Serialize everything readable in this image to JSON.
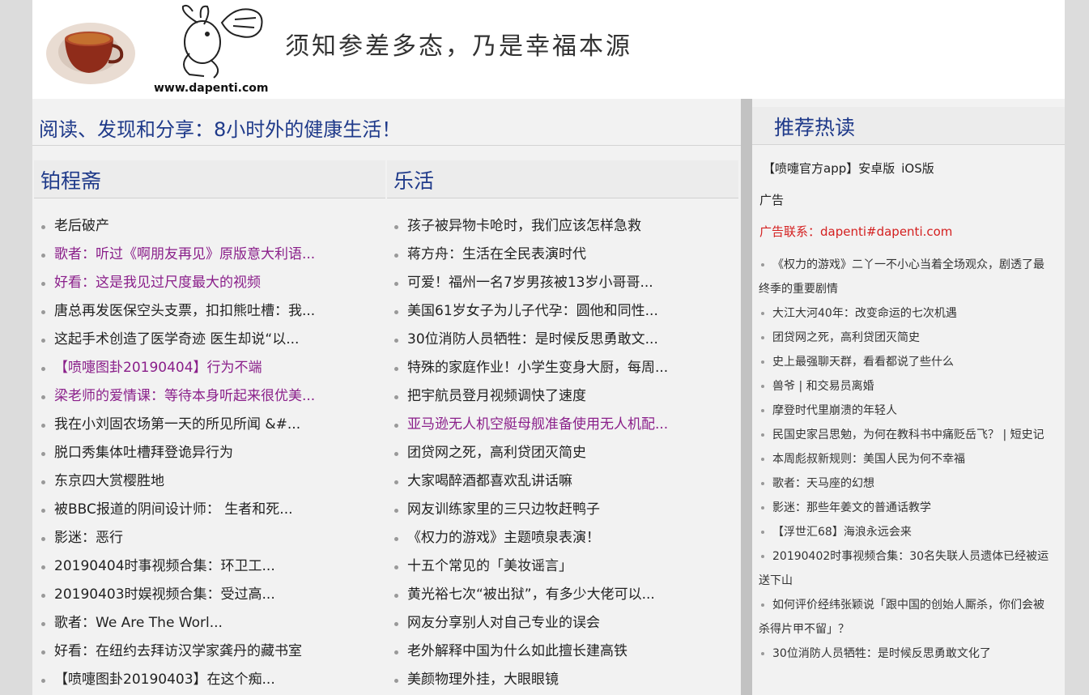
{
  "header": {
    "site_url": "www.dapenti.com",
    "slogan": "须知参差多态，乃是幸福本源"
  },
  "main": {
    "title": "阅读、发现和分享：8小时外的健康生活！"
  },
  "col1": {
    "heading": "铂程斋",
    "items": [
      {
        "text": "老后破产",
        "visited": false
      },
      {
        "text": "歌者：听过《啊朋友再见》原版意大利语...",
        "visited": true
      },
      {
        "text": "好看：这是我见过尺度最大的视频",
        "visited": true
      },
      {
        "text": "唐总再发医保空头支票，扣扣熊吐槽：我...",
        "visited": false
      },
      {
        "text": "这起手术创造了医学奇迹 医生却说“以...",
        "visited": false
      },
      {
        "text": "【喷嚏图卦20190404】行为不端",
        "visited": true
      },
      {
        "text": "梁老师的爱情课：等待本身听起来很优美...",
        "visited": true
      },
      {
        "text": "我在小刘固农场第一天的所见所闻 &#...",
        "visited": false
      },
      {
        "text": "脱口秀集体吐槽拜登诡异行为",
        "visited": false
      },
      {
        "text": "东京四大赏樱胜地",
        "visited": false
      },
      {
        "text": "被BBC报道的阴间设计师： 生者和死...",
        "visited": false
      },
      {
        "text": "影迷：恶行",
        "visited": false
      },
      {
        "text": "20190404时事视频合集：环卫工...",
        "visited": false
      },
      {
        "text": "20190403时娱视频合集：受过高...",
        "visited": false
      },
      {
        "text": "歌者：We Are The Worl...",
        "visited": false
      },
      {
        "text": "好看：在纽约去拜访汉学家龚丹的藏书室",
        "visited": false
      },
      {
        "text": "【喷嚏图卦20190403】在这个痴...",
        "visited": false
      }
    ]
  },
  "col2": {
    "heading": "乐活",
    "items": [
      {
        "text": "孩子被异物卡呛时，我们应该怎样急救",
        "visited": false
      },
      {
        "text": "蒋方舟：生活在全民表演时代",
        "visited": false
      },
      {
        "text": "可爱！福州一名7岁男孩被13岁小哥哥...",
        "visited": false
      },
      {
        "text": "美国61岁女子为儿子代孕：圆他和同性...",
        "visited": false
      },
      {
        "text": "30位消防人员牺牲：是时候反思勇敢文...",
        "visited": false
      },
      {
        "text": "特殊的家庭作业！小学生变身大厨，每周...",
        "visited": false
      },
      {
        "text": "把宇航员登月视频调快了速度",
        "visited": false
      },
      {
        "text": "亚马逊无人机空艇母舰准备使用无人机配...",
        "visited": true
      },
      {
        "text": "团贷网之死，高利贷团灭简史",
        "visited": false
      },
      {
        "text": "大家喝醉酒都喜欢乱讲话嘛",
        "visited": false
      },
      {
        "text": "网友训练家里的三只边牧赶鸭子",
        "visited": false
      },
      {
        "text": "《权力的游戏》主题喷泉表演！",
        "visited": false
      },
      {
        "text": "十五个常见的「美妆谣言」",
        "visited": false
      },
      {
        "text": "黄光裕七次“被出狱”，有多少大佬可以...",
        "visited": false
      },
      {
        "text": "网友分享别人对自己专业的误会",
        "visited": false
      },
      {
        "text": "老外解释中国为什么如此擅长建高铁",
        "visited": false
      },
      {
        "text": "美颜物理外挂，大眼眼镜",
        "visited": false
      }
    ]
  },
  "side": {
    "heading": "推荐热读",
    "app_label": "【喷嚏官方app】",
    "android": "安卓版",
    "ios": "iOS版",
    "ad_label": "广告",
    "ad_contact": "广告联系：dapenti#dapenti.com",
    "items": [
      "《权力的游戏》二丫一不小心当着全场观众，剧透了最终季的重要剧情",
      "大江大河40年：改变命运的七次机遇",
      "团贷网之死，高利贷团灭简史",
      "史上最强聊天群，看看都说了些什么",
      "兽爷 | 和交易员离婚",
      "摩登时代里崩溃的年轻人",
      "民国史家吕思勉，为何在教科书中痛贬岳飞？ | 短史记",
      "本周彪叔新规则：美国人民为何不幸福",
      "歌者：天马座的幻想",
      "影迷：那些年姜文的普通话教学",
      "【浮世汇68】海浪永远会来",
      "20190402时事视频合集：30名失联人员遗体已经被运送下山",
      "如何评价经纬张颖说「跟中国的创始人厮杀，你们会被杀得片甲不留」？",
      "30位消防人员牺牲：是时候反思勇敢文化了"
    ]
  },
  "colors": {
    "heading_blue": "#1f3a8a",
    "visited_purple": "#8a1f8a",
    "ad_red": "#d42020"
  }
}
